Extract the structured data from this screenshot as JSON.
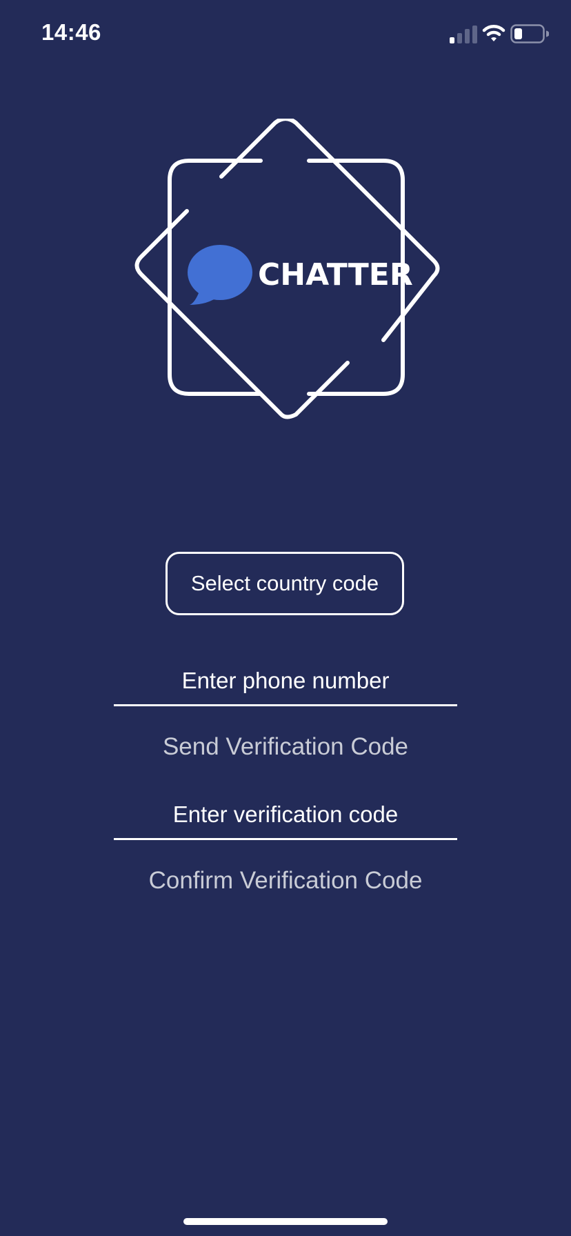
{
  "status_bar": {
    "time": "14:46",
    "icons": [
      "signal-icon",
      "wifi-icon",
      "battery-icon"
    ]
  },
  "logo": {
    "brand_name": "CHATTER",
    "icon": "chat-bubble-icon",
    "colors": {
      "frame": "#ffffff",
      "bubble": "#4270d4"
    }
  },
  "form": {
    "country_code_label": "Select country code",
    "phone_placeholder": "Enter phone number",
    "phone_value": "",
    "send_code_label": "Send Verification Code",
    "code_placeholder": "Enter verification code",
    "code_value": "",
    "confirm_code_label": "Confirm Verification Code"
  },
  "colors": {
    "background": "#232b58",
    "text": "#ffffff",
    "link_text": "#c9ccd6",
    "accent": "#4270d4"
  }
}
